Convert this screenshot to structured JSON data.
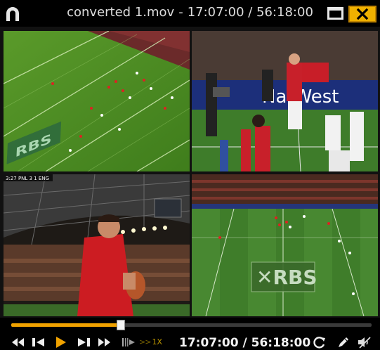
{
  "window": {
    "title_file": "converted 1.mov",
    "title_separator": "-",
    "title_time": "17:07:00 / 56:18:00"
  },
  "video": {
    "panes": [
      {
        "name": "top-left-view",
        "logo": "RBS"
      },
      {
        "name": "top-right-view",
        "banner": "NatWest"
      },
      {
        "name": "bottom-left-view",
        "overlay": "3:27 PNL 3 1 ENG"
      },
      {
        "name": "bottom-right-view",
        "logo": "RBS"
      }
    ]
  },
  "controls": {
    "progress_fraction": 0.304,
    "rate_arrows": ">>",
    "rate_label": "1X",
    "time_display": "17:07:00 / 56:18:00",
    "accent_color": "#f0a200"
  }
}
